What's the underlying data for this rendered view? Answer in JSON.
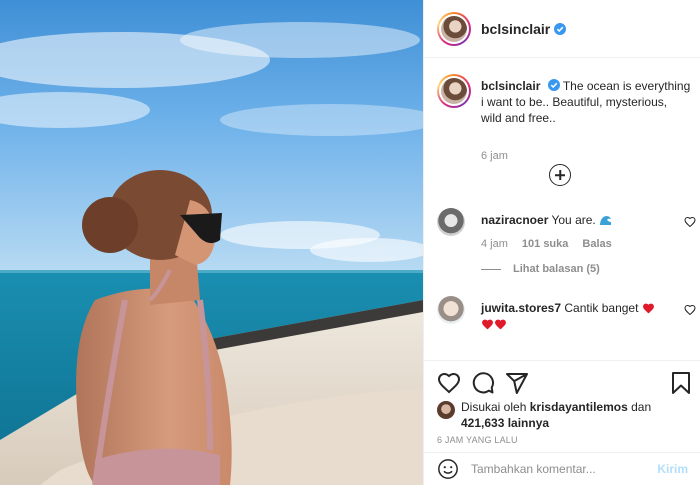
{
  "post": {
    "username": "bclsinclair",
    "verified": true
  },
  "caption": {
    "username": "bclsinclair",
    "text": "The ocean is everything i want to be.. Beautiful, mysterious, wild and free..",
    "time": "6 jam"
  },
  "comments": [
    {
      "username": "naziracnoer",
      "text": "You are.",
      "time": "4 jam",
      "likes": "101 suka",
      "reply_label": "Balas",
      "view_replies": "Lihat balasan (5)"
    },
    {
      "username": "juwita.stores7",
      "text": "Cantik banget"
    }
  ],
  "likes": {
    "prefix": "Disukai oleh",
    "user": "krisdayantilemos",
    "joiner": "dan",
    "count": "421,633 lainnya"
  },
  "timestamp": "6 JAM YANG LALU",
  "add_comment": {
    "placeholder": "Tambahkan komentar...",
    "post_label": "Kirim"
  },
  "icons": {
    "verified": "verified-badge-icon",
    "like": "heart-icon",
    "comment": "comment-icon",
    "share": "share-icon",
    "save": "bookmark-icon",
    "emoji": "smiley-icon",
    "more": "plus-circle-icon"
  },
  "colors": {
    "verified_blue": "#3897f0",
    "heart_red": "#ed4956",
    "post_disabled": "#b2dffc",
    "muted_text": "#8e8e8e"
  }
}
